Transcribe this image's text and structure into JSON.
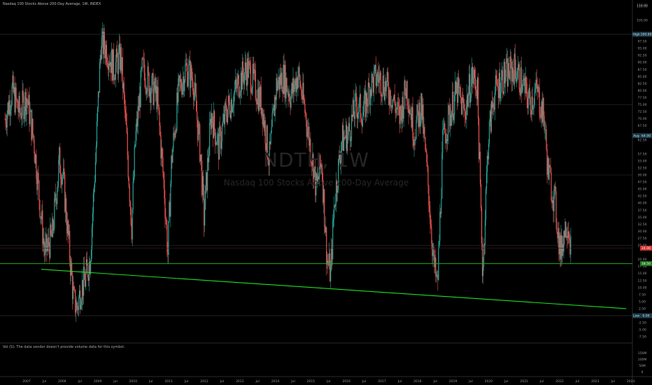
{
  "header": {
    "title": "Nasdaq 100 Stocks Above 200-Day Average, 1W, INDEX"
  },
  "watermark": {
    "symbol": "NDTH, 1W",
    "description": "Nasdaq 100 Stocks Above 200-Day Average"
  },
  "volume_note": "Vol (S): The data vendor doesn't provide volume data for this symbol.",
  "colors": {
    "background": "#000000",
    "up_candle": "#26a69a",
    "down_candle": "#ef5350",
    "trendline": "#22dd22",
    "horizontal_line": "#22aa22",
    "grid": "#1a1a1a"
  },
  "price_axis": {
    "labels": [
      "110.00",
      "105.00",
      "100.00",
      "97.50",
      "95.00",
      "92.50",
      "90.00",
      "87.50",
      "85.00",
      "82.50",
      "80.00",
      "77.50",
      "75.00",
      "72.50",
      "70.00",
      "67.50",
      "62.50",
      "57.50",
      "55.00",
      "52.50",
      "50.00",
      "47.50",
      "45.00",
      "42.50",
      "40.00",
      "37.50",
      "35.00",
      "32.50",
      "30.00",
      "27.50",
      "25.00",
      "20.00",
      "17.50",
      "15.00",
      "12.50",
      "10.00",
      "7.50",
      "5.00",
      "2.50",
      "0.00",
      "-2.50",
      "-5.00",
      "-7.50"
    ],
    "volume_labels": [
      "150M",
      "100M",
      "50M",
      "0"
    ],
    "badges": [
      {
        "name": "high",
        "tag": "High",
        "value": "100.00",
        "color": "#1e3a4a",
        "text_color": "#bfe3ea"
      },
      {
        "name": "avg",
        "tag": "Avg",
        "value": "64.00",
        "color": "#1e3a4a",
        "text_color": "#bfe3ea"
      },
      {
        "name": "last",
        "tag": "",
        "value": "24.00",
        "color": "#d03030",
        "text_color": "#ffffff"
      },
      {
        "name": "hline",
        "tag": "",
        "value": "18.50",
        "color": "#1f7a1f",
        "text_color": "#ffffff"
      },
      {
        "name": "low",
        "tag": "Low",
        "value": "0.00",
        "color": "#1e3a4a",
        "text_color": "#bfe3ea"
      }
    ]
  },
  "time_axis": {
    "labels": [
      "2007",
      "Jul",
      "2008",
      "Jul",
      "2009",
      "Jul",
      "2010",
      "Jul",
      "2011",
      "Jul",
      "2012",
      "Jul",
      "2013",
      "Jul",
      "2014",
      "Jul",
      "2015",
      "Jul",
      "2016",
      "Jul",
      "2017",
      "Jul",
      "2018",
      "Jul",
      "2019",
      "Jul",
      "2020",
      "Jul",
      "2021",
      "Jul",
      "2022",
      "Jul",
      "2023",
      "Jul",
      "2024"
    ]
  },
  "chart_data": {
    "type": "candlestick",
    "title": "Nasdaq 100 Stocks Above 200-Day Average, 1W, INDEX",
    "timeframe": "1W",
    "x_range": [
      "2007-01",
      "2024-03"
    ],
    "ylim": [
      -7.5,
      110
    ],
    "grid": true,
    "approx_series": {
      "name": "NDTH",
      "x": [
        2007.0,
        2007.2,
        2007.4,
        2007.6,
        2007.8,
        2008.0,
        2008.1,
        2008.3,
        2008.5,
        2008.6,
        2008.8,
        2008.9,
        2009.0,
        2009.1,
        2009.2,
        2009.35,
        2009.5,
        2009.65,
        2009.8,
        2010.0,
        2010.2,
        2010.35,
        2010.5,
        2010.6,
        2010.8,
        2011.0,
        2011.2,
        2011.4,
        2011.5,
        2011.6,
        2011.8,
        2012.0,
        2012.2,
        2012.4,
        2012.5,
        2012.7,
        2012.9,
        2013.1,
        2013.3,
        2013.5,
        2013.7,
        2013.9,
        2014.1,
        2014.3,
        2014.5,
        2014.7,
        2014.9,
        2015.1,
        2015.3,
        2015.5,
        2015.6,
        2015.75,
        2015.9,
        2016.0,
        2016.1,
        2016.3,
        2016.5,
        2016.7,
        2016.9,
        2017.1,
        2017.3,
        2017.5,
        2017.7,
        2017.9,
        2018.1,
        2018.3,
        2018.5,
        2018.7,
        2018.85,
        2018.95,
        2019.1,
        2019.3,
        2019.5,
        2019.7,
        2019.9,
        2020.05,
        2020.2,
        2020.35,
        2020.5,
        2020.7,
        2020.9,
        2021.1,
        2021.3,
        2021.5,
        2021.7,
        2021.9,
        2022.0,
        2022.2,
        2022.35,
        2022.45,
        2022.55,
        2022.65
      ],
      "y": [
        70,
        80,
        72,
        78,
        62,
        35,
        22,
        28,
        55,
        50,
        20,
        5,
        3,
        10,
        12,
        20,
        55,
        97,
        95,
        88,
        92,
        65,
        32,
        62,
        88,
        82,
        78,
        45,
        22,
        55,
        80,
        88,
        84,
        58,
        35,
        72,
        60,
        72,
        78,
        84,
        88,
        82,
        75,
        55,
        82,
        85,
        78,
        86,
        72,
        55,
        45,
        55,
        20,
        15,
        40,
        62,
        65,
        75,
        72,
        82,
        85,
        82,
        78,
        70,
        82,
        65,
        75,
        45,
        18,
        10,
        62,
        72,
        80,
        72,
        85,
        82,
        15,
        62,
        78,
        84,
        86,
        88,
        82,
        76,
        80,
        70,
        52,
        40,
        22,
        30,
        34,
        24
      ]
    },
    "annotations": {
      "horizontal_line_value": 18.5,
      "trendline": {
        "from": [
          "2008-01",
          16.5
        ],
        "to": [
          "2024-03",
          2.5
        ]
      },
      "high": 100.0,
      "low": 0.0,
      "last": 24.0
    }
  }
}
